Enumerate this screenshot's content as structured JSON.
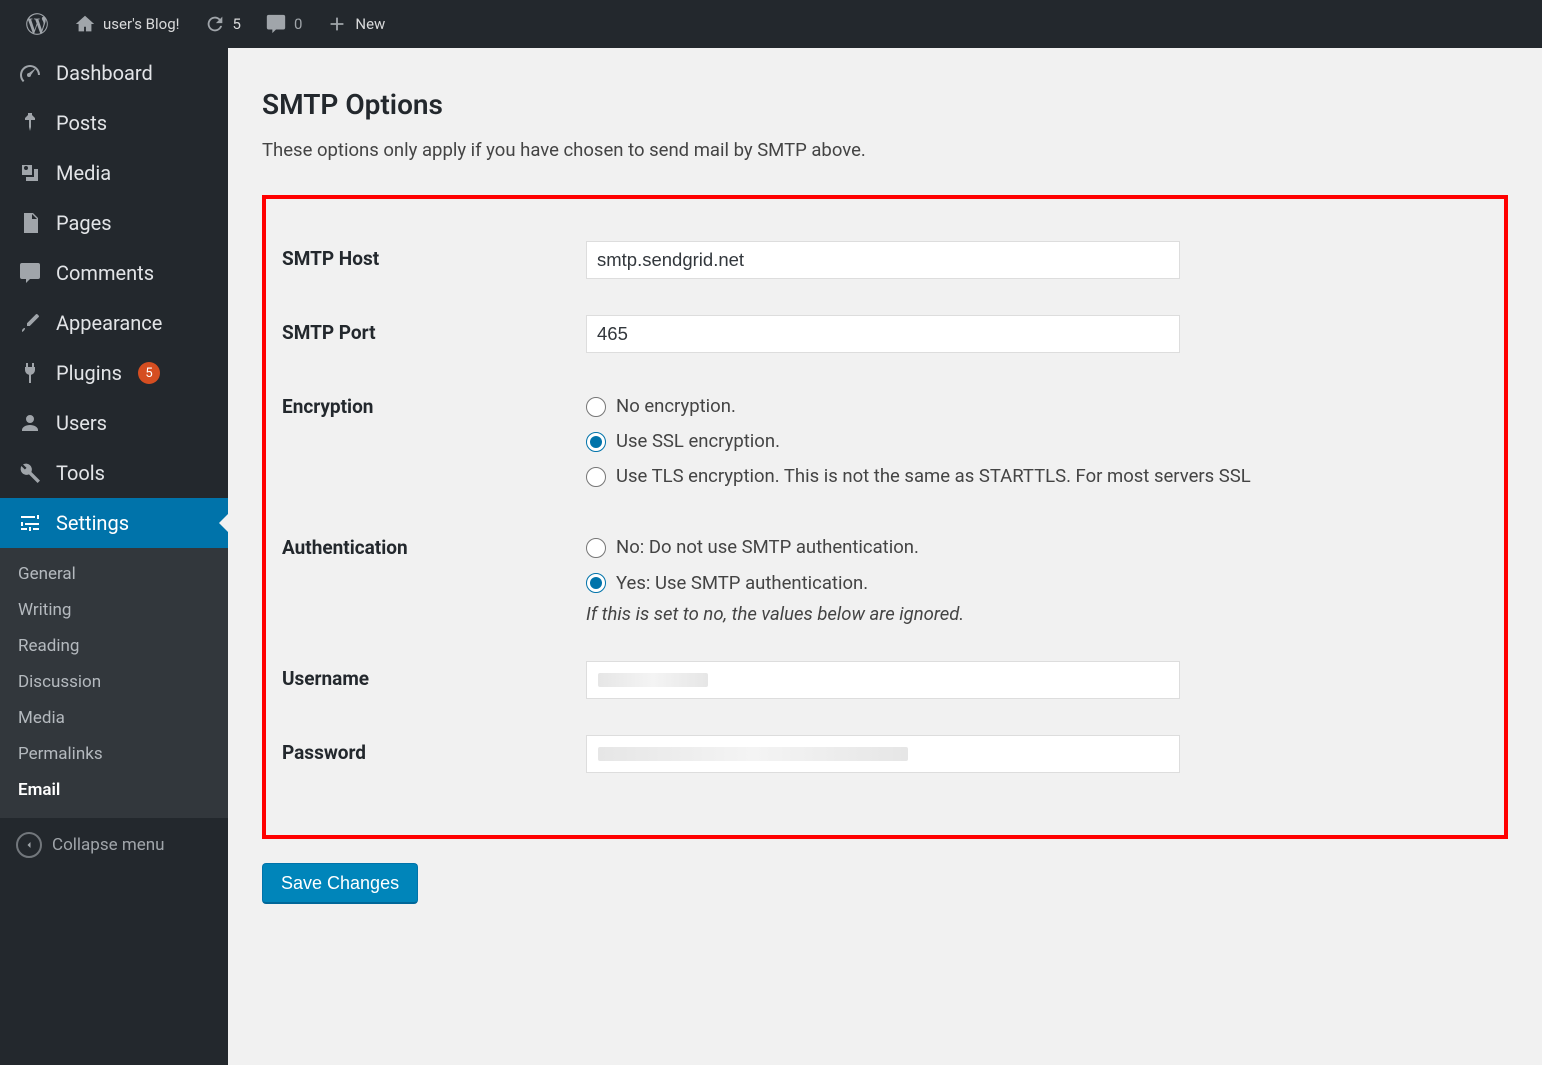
{
  "adminbar": {
    "site_name": "user's Blog!",
    "updates_count": "5",
    "comments_count": "0",
    "new_label": "New"
  },
  "sidebar": {
    "items": [
      {
        "label": "Dashboard"
      },
      {
        "label": "Posts"
      },
      {
        "label": "Media"
      },
      {
        "label": "Pages"
      },
      {
        "label": "Comments"
      },
      {
        "label": "Appearance"
      },
      {
        "label": "Plugins",
        "badge": "5"
      },
      {
        "label": "Users"
      },
      {
        "label": "Tools"
      },
      {
        "label": "Settings"
      }
    ],
    "submenu": [
      {
        "label": "General"
      },
      {
        "label": "Writing"
      },
      {
        "label": "Reading"
      },
      {
        "label": "Discussion"
      },
      {
        "label": "Media"
      },
      {
        "label": "Permalinks"
      },
      {
        "label": "Email"
      }
    ],
    "collapse_label": "Collapse menu"
  },
  "main": {
    "section_title": "SMTP Options",
    "section_desc": "These options only apply if you have chosen to send mail by SMTP above.",
    "fields": {
      "smtp_host": {
        "label": "SMTP Host",
        "value": "smtp.sendgrid.net"
      },
      "smtp_port": {
        "label": "SMTP Port",
        "value": "465"
      },
      "encryption": {
        "label": "Encryption",
        "options": [
          "No encryption.",
          "Use SSL encryption.",
          "Use TLS encryption. This is not the same as STARTTLS. For most servers SSL"
        ],
        "selected_index": 1
      },
      "authentication": {
        "label": "Authentication",
        "options": [
          "No: Do not use SMTP authentication.",
          "Yes: Use SMTP authentication."
        ],
        "selected_index": 1,
        "help": "If this is set to no, the values below are ignored."
      },
      "username": {
        "label": "Username",
        "value": ""
      },
      "password": {
        "label": "Password",
        "value": ""
      }
    },
    "save_label": "Save Changes"
  }
}
